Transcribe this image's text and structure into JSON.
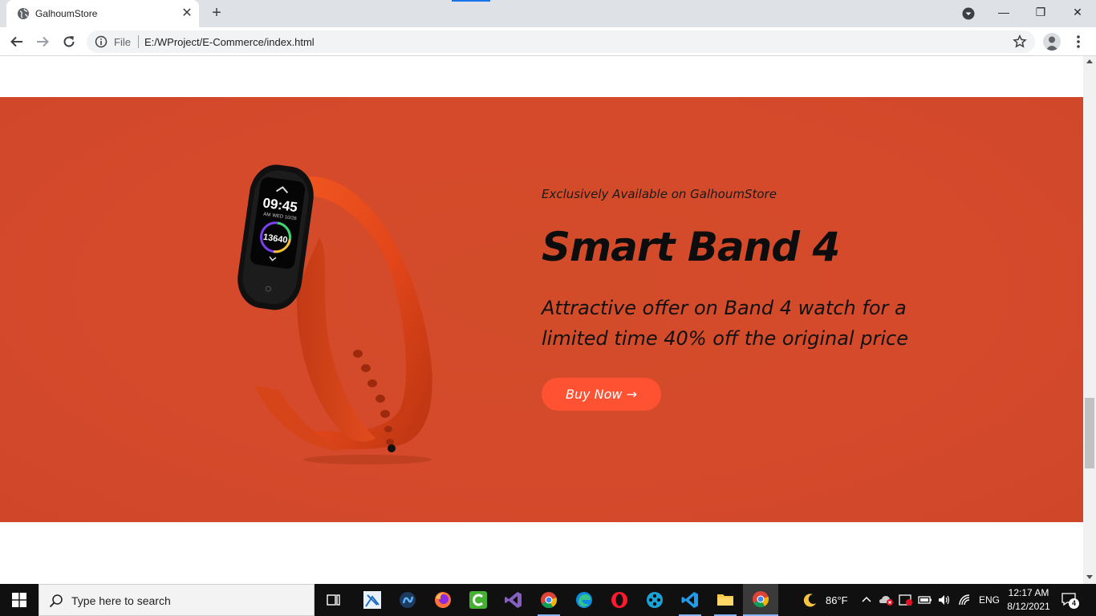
{
  "browser": {
    "tab_title": "GalhoumStore",
    "tab_close": "✕",
    "new_tab": "+",
    "omnibox_file": "File",
    "omnibox_url": "E:/WProject/E-Commerce/index.html",
    "window_minimize": "—",
    "window_restore": "❐",
    "window_close": "✕"
  },
  "promo": {
    "eyebrow": "Exclusively Available on GalhoumStore",
    "headline": "Smart Band 4",
    "description": "Attractive offer on Band 4 watch for a limited time 40% off the original price",
    "button_label": "Buy Now →",
    "accent_color": "#d44a2a",
    "button_color": "#ff5233",
    "product_screen": {
      "time": "09:45",
      "date": "WED 10/26",
      "ampm": "AM",
      "steps": "13640"
    }
  },
  "taskbar": {
    "search_placeholder": "Type here to search",
    "weather_temp": "86°F",
    "language": "ENG",
    "time": "12:17 AM",
    "date": "8/12/2021",
    "notifications": "4",
    "apps": [
      "task-view",
      "snipping-tool",
      "app-blue-circle",
      "firefox",
      "camtasia",
      "visual-studio",
      "chrome",
      "edge",
      "opera",
      "app-film",
      "vscode",
      "file-explorer",
      "chrome-active"
    ]
  }
}
